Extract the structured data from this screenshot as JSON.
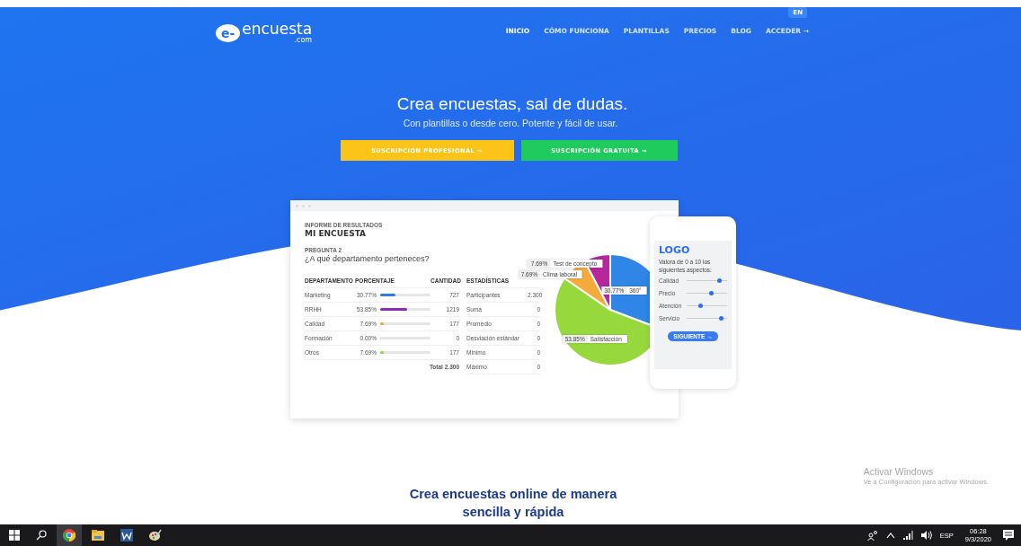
{
  "header": {
    "logo": {
      "mark": "e-",
      "name": "encuesta",
      "suffix": ".com"
    },
    "language_button": "EN",
    "nav": [
      {
        "label": "INICIO",
        "selected": true
      },
      {
        "label": "CÓMO FUNCIONA",
        "selected": false
      },
      {
        "label": "PLANTILLAS",
        "selected": false
      },
      {
        "label": "PRECIOS",
        "selected": false
      },
      {
        "label": "BLOG",
        "selected": false
      },
      {
        "label": "ACCEDER →",
        "selected": false
      }
    ]
  },
  "hero": {
    "title": "Crea encuestas, sal de dudas.",
    "subtitle": "Con plantillas o desde cero. Potente y fácil de usar.",
    "buttons": [
      {
        "label": "SUSCRIPCIÓN PROFESIONAL →",
        "kind": "pro"
      },
      {
        "label": "SUSCRIPCIÓN GRATUITA →",
        "kind": "free"
      }
    ]
  },
  "report": {
    "eyebrow": "INFORME DE RESULTADOS",
    "title": "MI ENCUESTA",
    "question_label": "PREGUNTA 2",
    "question": "¿A qué departamento perteneces?",
    "table": {
      "columns": [
        "DEPARTAMENTO",
        "PORCENTAJE",
        "CANTIDAD"
      ],
      "rows": [
        {
          "department": "Marketing",
          "percent": "30.77%",
          "level": 0.3077,
          "color": "#2f7be6",
          "count": "727"
        },
        {
          "department": "RRHH",
          "percent": "53.85%",
          "level": 0.5385,
          "color": "#8e2bb5",
          "count": "1219"
        },
        {
          "department": "Calidad",
          "percent": "7.69%",
          "level": 0.0769,
          "color": "#f2a531",
          "count": "177"
        },
        {
          "department": "Formación",
          "percent": "0.00%",
          "level": 0,
          "count": "0"
        },
        {
          "department": "Otros",
          "percent": "7.69%",
          "level": 0.0769,
          "color": "#8ed63a",
          "count": "177"
        }
      ],
      "total": "Total 2.300"
    },
    "stats": {
      "heading": "ESTADÍSTICAS",
      "rows": [
        {
          "label": "Participantes",
          "value": "2.300"
        },
        {
          "label": "Suma",
          "value": "0"
        },
        {
          "label": "Promedio",
          "value": "0"
        },
        {
          "label": "Desviación estándar",
          "value": "0"
        },
        {
          "label": "Mínimo",
          "value": "0"
        },
        {
          "label": "Máximo",
          "value": "0"
        }
      ]
    },
    "chart_data": {
      "type": "pie",
      "categories": [
        "360°",
        "Satisfacción",
        "Clima laboral",
        "Test de concepto"
      ],
      "values": [
        30.77,
        53.85,
        7.69,
        7.69
      ],
      "value_labels": [
        "30.77%",
        "53.85%",
        "7.69%",
        "7.69%"
      ],
      "colors": [
        "#2f86e6",
        "#97d93c",
        "#f5aa3c",
        "#b5279c"
      ]
    }
  },
  "phone": {
    "logo": "LOGO",
    "prompt": "Valora de 0 a 10 los siguientes aspectos:",
    "sliders": [
      {
        "label": "Calidad",
        "level": 0.8
      },
      {
        "label": "Precio",
        "level": 0.6
      },
      {
        "label": "Atención",
        "level": 0.35
      },
      {
        "label": "Servicio",
        "level": 0.85
      }
    ],
    "button": "SIGUIENTE →"
  },
  "section_heading": "Crea encuestas online de manera sencilla y rápida",
  "activation_notice": {
    "title": "Activar Windows",
    "text": "Ve a Configuración para activar Windows."
  },
  "taskbar": {
    "language": "ESP",
    "time": "06:28",
    "date": "9/3/2020"
  }
}
